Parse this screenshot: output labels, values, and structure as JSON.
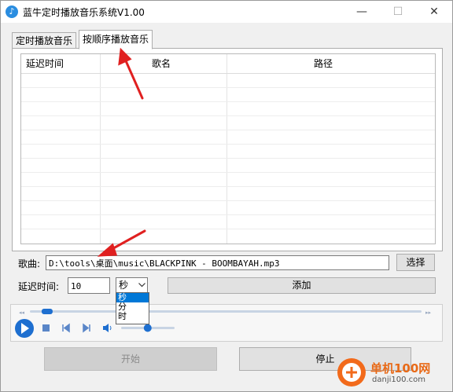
{
  "window": {
    "title": "蓝牛定时播放音乐系统V1.00",
    "minimize": "—",
    "maximize": "☐",
    "close": "✕"
  },
  "tabs": [
    {
      "label": "定时播放音乐",
      "active": false
    },
    {
      "label": "按顺序播放音乐",
      "active": true
    }
  ],
  "table": {
    "columns": [
      "延迟时间",
      "歌名",
      "路径"
    ],
    "rows": []
  },
  "song": {
    "label": "歌曲:",
    "value": "D:\\tools\\桌面\\music\\BLACKPINK - BOOMBAYAH.mp3",
    "choose_label": "选择"
  },
  "delay": {
    "label": "延迟时间:",
    "value": "10",
    "unit_selected": "秒",
    "unit_options": [
      "秒",
      "分",
      "时"
    ],
    "add_label": "添加"
  },
  "player": {
    "progress": 0.03,
    "volume": 0.6,
    "icons": [
      "play-icon",
      "stop-icon",
      "previous-icon",
      "next-icon",
      "volume-icon"
    ]
  },
  "actions": {
    "start_label": "开始",
    "stop_label": "停止"
  },
  "watermark": {
    "text": "单机100网",
    "url": "danji100.com"
  },
  "colors": {
    "accent": "#0078d7",
    "annotation_arrow": "#e02020",
    "play_button": "#1e6fd0"
  }
}
